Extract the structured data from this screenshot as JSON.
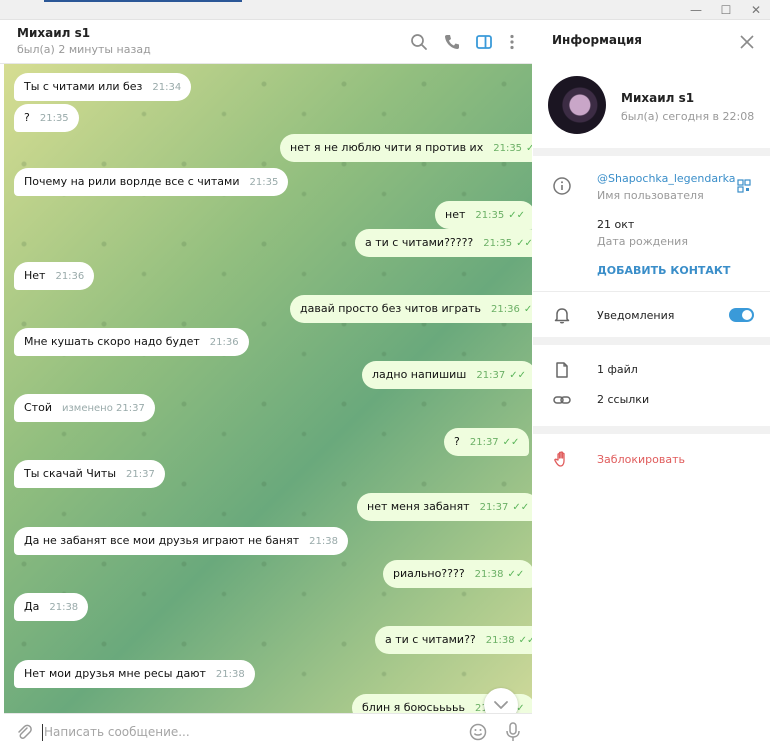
{
  "window": {
    "minimize_label": "—",
    "maximize_label": "☐",
    "close_label": "✕"
  },
  "chat": {
    "title": "Михаил s1",
    "status": "был(а) 2 минуты назад"
  },
  "messages": [
    {
      "dir": "in",
      "text": "Ты с читами или без",
      "time": "21:34"
    },
    {
      "dir": "in",
      "text": "?",
      "time": "21:35"
    },
    {
      "dir": "out",
      "text": "нет я не люблю чити я против их",
      "time": "21:35"
    },
    {
      "dir": "in",
      "text": "Почему на рили ворлде все с читами",
      "time": "21:35"
    },
    {
      "dir": "out",
      "text": "нет",
      "time": "21:35"
    },
    {
      "dir": "out",
      "text": "а ти с читами?????",
      "time": "21:35"
    },
    {
      "dir": "in",
      "text": "Нет",
      "time": "21:36"
    },
    {
      "dir": "out",
      "text": "давай просто без читов играть",
      "time": "21:36"
    },
    {
      "dir": "in",
      "text": "Мне кушать скоро надо будет",
      "time": "21:36"
    },
    {
      "dir": "out",
      "text": "ладно напишиш",
      "time": "21:37"
    },
    {
      "dir": "in",
      "text": "Стой",
      "time": "изменено 21:37"
    },
    {
      "dir": "out",
      "text": "?",
      "time": "21:37"
    },
    {
      "dir": "in",
      "text": "Ты скачай Читы",
      "time": "21:37"
    },
    {
      "dir": "out",
      "text": "нет меня забанят",
      "time": "21:37"
    },
    {
      "dir": "in",
      "text": "Да не забанят все мои друзья играют не банят",
      "time": "21:38"
    },
    {
      "dir": "out",
      "text": "риально????",
      "time": "21:38"
    },
    {
      "dir": "in",
      "text": "Да",
      "time": "21:38"
    },
    {
      "dir": "out",
      "text": "а ти с читами??",
      "time": "21:38"
    },
    {
      "dir": "in",
      "text": "Нет мои друзья мне ресы дают",
      "time": "21:38"
    },
    {
      "dir": "out",
      "text": "блин я боюсььььь",
      "time": "21:38"
    }
  ],
  "composer": {
    "placeholder": "Написать сообщение..."
  },
  "info": {
    "title": "Информация",
    "name": "Михаил s1",
    "last_seen": "был(а) сегодня в 22:08",
    "username": "@Shapochka_legendarka",
    "username_label": "Имя пользователя",
    "birthday": "21 окт",
    "birthday_label": "Дата рождения",
    "add_contact": "ДОБАВИТЬ КОНТАКТ",
    "notifications": "Уведомления",
    "notifications_on": true,
    "files": "1 файл",
    "links": "2 ссылки",
    "block": "Заблокировать"
  },
  "colors": {
    "accent": "#3a9ad9",
    "link": "#3a8ec9",
    "danger": "#e05c5c",
    "outgoing_bubble": "#effdde",
    "incoming_bubble": "#ffffff",
    "ticks": "#5bb55a"
  }
}
